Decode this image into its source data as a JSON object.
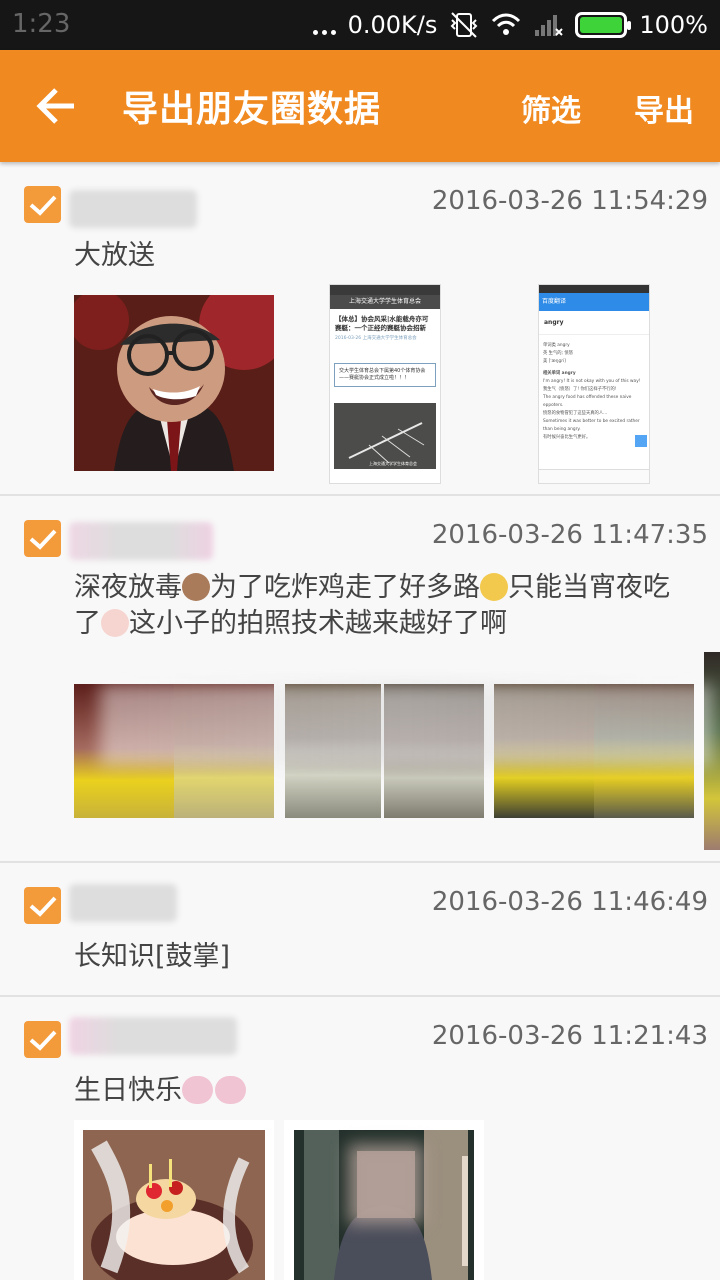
{
  "status_bar": {
    "time": "1:23",
    "speed": "0.00K/s",
    "battery": "100%"
  },
  "header": {
    "title": "导出朋友圈数据",
    "filter_label": "筛选",
    "export_label": "导出"
  },
  "posts": [
    {
      "timestamp": "2016-03-26 11:54:29",
      "text": "大放送"
    },
    {
      "timestamp": "2016-03-26 11:47:35",
      "text_line1_a": "深夜放毒",
      "text_line1_b": "为了吃炸鸡走了好多路",
      "text_line1_c": "只能当宵夜吃",
      "text_line2_a": "了",
      "text_line2_b": "这小子的拍照技术越来越好了啊"
    },
    {
      "timestamp": "2016-03-26 11:46:49",
      "text": "长知识[鼓掌]"
    },
    {
      "timestamp": "2016-03-26 11:21:43",
      "text": "生日快乐"
    }
  ],
  "screenshot1": {
    "header": "上海交通大学学生体育总会",
    "article_title_1": "【体总】协会风采|水能载舟亦可",
    "article_title_2": "赛艇：一个正经的赛艇协会招新",
    "date": "2016-03-26 上海交通大学学生体育总会",
    "quote": "交大学生体育总会下属第40个体育协会——赛艇协会正式成立啦！！！",
    "caption": "上海交通大学学生体育总会"
  },
  "screenshot2": {
    "header": "百度翻译",
    "word": "angry",
    "lines": [
      "单词类 angry",
      "英 生气的; 愤怒",
      "美 [ˈæŋɡri]",
      "相关单词 angry",
      "I'm angry! It is not okay with you of this way!",
      "我生气（愤怒）了! 你们这样子不行的!",
      "The angry food has offended these naive eppoters.",
      "愤怒的食物冒犯了这些天真的人...",
      "Sometimes it was better to be excited rather than being angry.",
      "有时候兴奋比生气更好。"
    ]
  },
  "colors": {
    "accent": "#f0891f",
    "checkbox": "#f39a3a",
    "status_bg": "#161616"
  }
}
